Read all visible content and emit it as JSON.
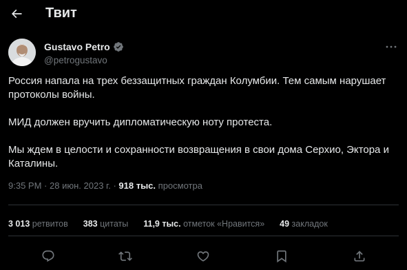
{
  "header": {
    "title": "Твит"
  },
  "author": {
    "name": "Gustavo Petro",
    "handle": "@petrogustavo",
    "verified": true
  },
  "tweet": {
    "paragraphs": [
      "Россия напала на трех беззащитных граждан Колумбии. Тем самым нарушает протоколы войны.",
      "МИД должен вручить дипломатическую ноту протеста.",
      "Мы ждем в целости и сохранности возвращения в свои дома Серхио, Эктора и Каталины."
    ]
  },
  "meta": {
    "time": "9:35 PM",
    "date": "28 июн. 2023 г.",
    "separator": "·",
    "views_count": "918 тыс.",
    "views_label": "просмотра"
  },
  "stats": {
    "retweets": {
      "count": "3 013",
      "label": "ретвитов"
    },
    "quotes": {
      "count": "383",
      "label": "цитаты"
    },
    "likes": {
      "count": "11,9 тыс.",
      "label": "отметок «Нравится»"
    },
    "bookmarks": {
      "count": "49",
      "label": "закладок"
    }
  },
  "colors": {
    "background": "#000000",
    "text": "#e7e9ea",
    "secondary": "#71767b",
    "divider": "#2f3336",
    "verified": "#1d9bf0"
  },
  "icons": {
    "back": "arrow-left-icon",
    "verified": "verified-badge-icon",
    "more": "more-horizontal-icon",
    "reply": "reply-icon",
    "retweet": "retweet-icon",
    "like": "heart-icon",
    "bookmark": "bookmark-icon",
    "share": "share-icon"
  }
}
